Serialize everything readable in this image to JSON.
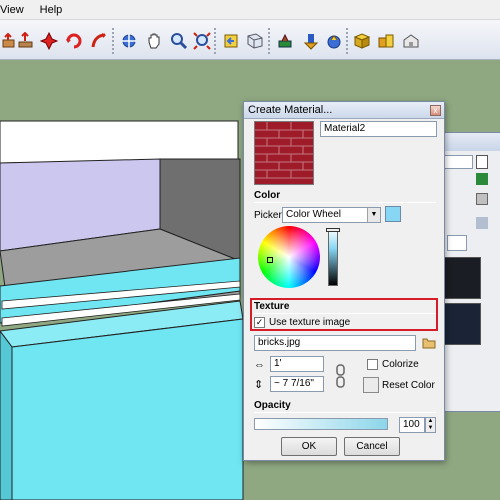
{
  "menubar": {
    "items": [
      "View",
      "Help"
    ]
  },
  "toolbar": {
    "tools": [
      "push-pull-icon",
      "move-icon",
      "rotate-icon",
      "follow-me-icon",
      "scale-icon",
      "orbit-icon",
      "pan-icon",
      "zoom-icon",
      "zoom-extents-icon",
      "previous-view-icon",
      "next-view-icon",
      "place-model-icon",
      "get-models-icon",
      "share-model-icon",
      "components-icon",
      "styles-icon",
      "warehouse-icon"
    ]
  },
  "dialog": {
    "title": "Create Material...",
    "close_symbol": "x",
    "material_name": "Material2",
    "color_section": "Color",
    "picker_label": "Picker:",
    "picker_value": "Color Wheel",
    "picker_swatch_color": "#86d6f4",
    "texture_section": "Texture",
    "use_texture_label": "Use texture image",
    "use_texture_checked": "✓",
    "texture_file": "bricks.jpg",
    "width_value": "1'",
    "height_value": "~ 7 7/16\"",
    "colorize_label": "Colorize",
    "reset_color_label": "Reset Color",
    "opacity_section": "Opacity",
    "opacity_value": "100",
    "ok_label": "OK",
    "cancel_label": "Cancel",
    "highlight_color": "#d61c26"
  },
  "colors": {
    "scene_background": "#8fa882",
    "cyan_face": "#6fe6f2",
    "lavender_face": "#c9c6ec",
    "brick_red": "#9e1c2a"
  }
}
